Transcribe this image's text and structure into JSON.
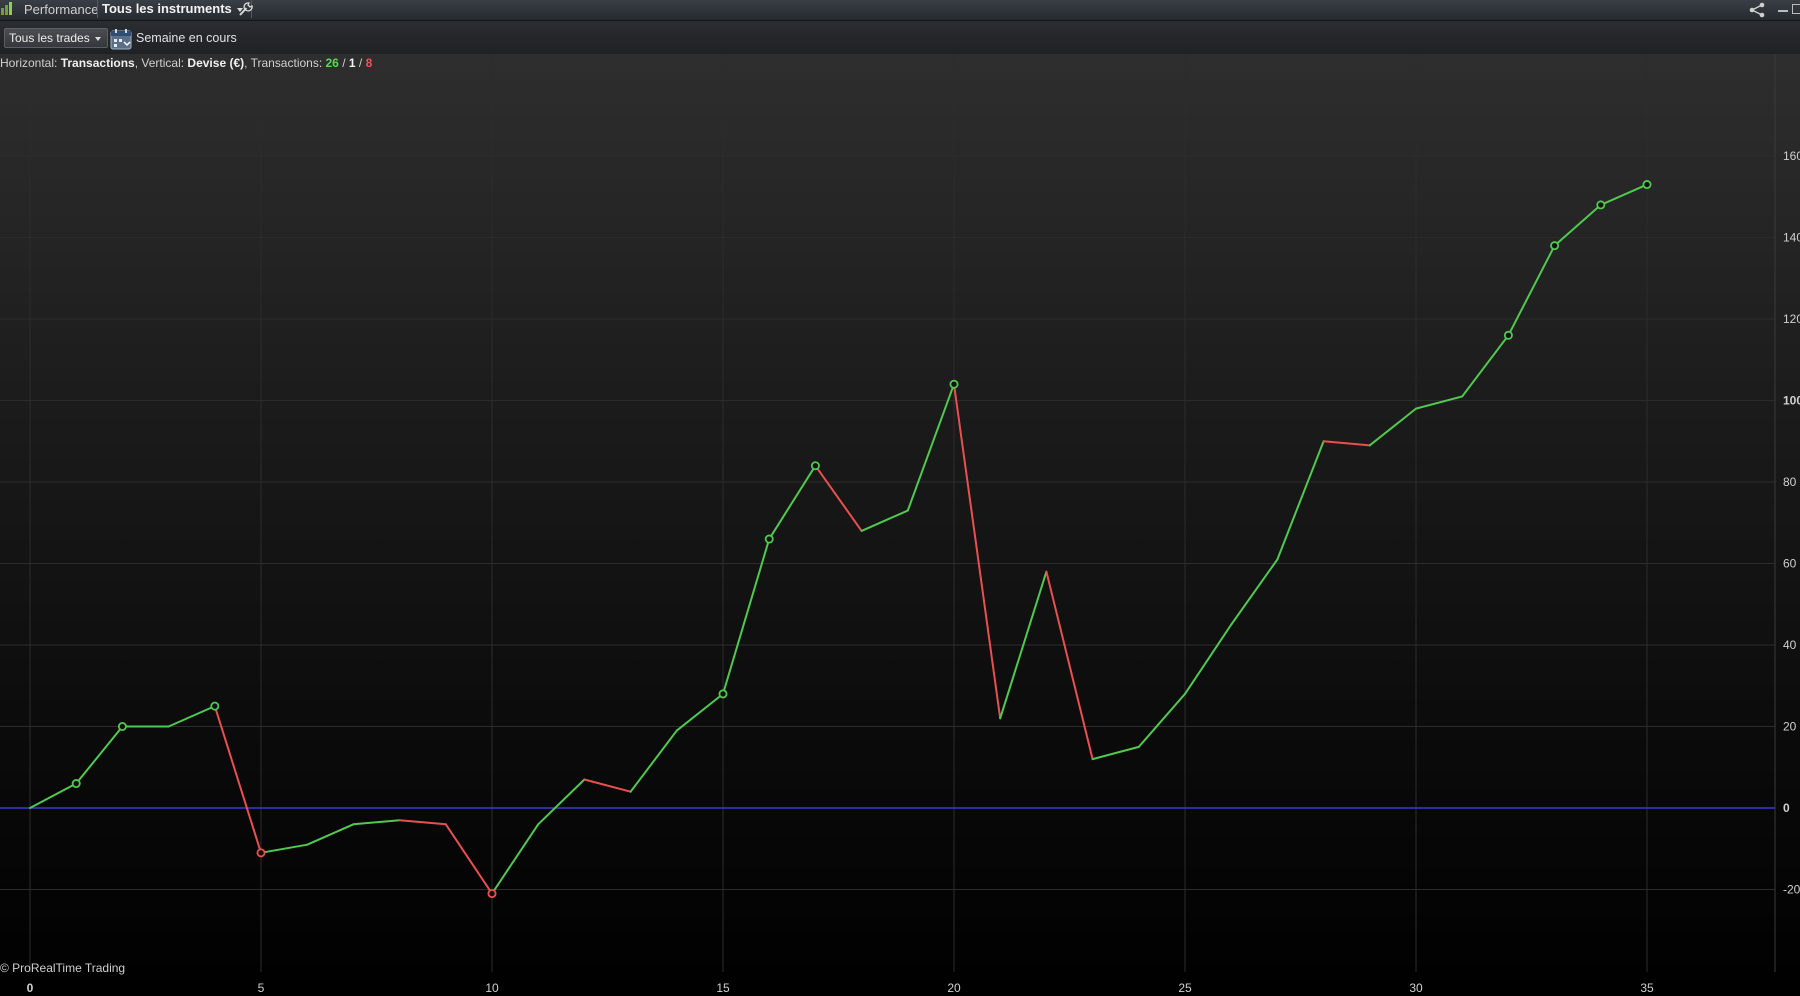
{
  "window": {
    "title": "Performance",
    "instrument_selector": "Tous les instruments",
    "icons": [
      "app-icon",
      "wrench-icon",
      "share-icon",
      "minimize-icon",
      "restore-icon"
    ]
  },
  "toolbar": {
    "trades_filter": "Tous les trades",
    "period_label": "Semaine en cours",
    "icons": [
      "calendar-icon"
    ]
  },
  "info": {
    "horizontal_prefix": "Horizontal: ",
    "horizontal_value": "Transactions",
    "vertical_prefix": ", Vertical: ",
    "vertical_value": "Devise (€)",
    "transactions_prefix": ", Transactions: ",
    "winning": "26",
    "sep1": " / ",
    "neutral": "1",
    "sep2": " / ",
    "losing": "8"
  },
  "footer": {
    "copyright": "© ProRealTime Trading"
  },
  "colors": {
    "gain": "#4fc94f",
    "loss": "#e8504f",
    "zero_line": "#3a3ad8",
    "grid": "#2c2c2c",
    "text": "#d0d0d0"
  },
  "chart_data": {
    "type": "line",
    "title": "",
    "xlabel": "Transactions",
    "ylabel": "Devise (€)",
    "xlim": [
      0,
      38
    ],
    "ylim": [
      -34,
      168
    ],
    "x_ticks": [
      0,
      5,
      10,
      15,
      20,
      25,
      30,
      35
    ],
    "y_ticks": [
      -20,
      0,
      20,
      40,
      60,
      80,
      100,
      120,
      140,
      160
    ],
    "bold_ticks": [
      0,
      100
    ],
    "grid": true,
    "legend": "none",
    "series": [
      {
        "x": [
          0,
          1,
          2,
          3,
          4,
          5,
          6,
          7,
          8,
          9,
          10,
          11,
          12,
          13,
          14,
          15,
          16,
          17,
          18,
          19,
          20,
          21,
          22,
          23,
          24,
          25,
          26,
          27,
          28,
          29,
          30,
          31,
          32,
          33,
          34,
          35
        ],
        "values": [
          0,
          6,
          20,
          20,
          25,
          -11,
          -9,
          -4,
          -3,
          -4,
          -21,
          -4,
          7,
          4,
          19,
          28,
          66,
          84,
          68,
          73,
          104,
          22,
          58,
          12,
          15,
          28,
          45,
          61,
          90,
          89,
          98,
          101,
          116,
          138,
          148,
          153
        ],
        "markers_at": [
          1,
          2,
          4,
          5,
          10,
          15,
          16,
          17,
          20,
          32,
          33,
          34,
          35
        ]
      }
    ]
  }
}
